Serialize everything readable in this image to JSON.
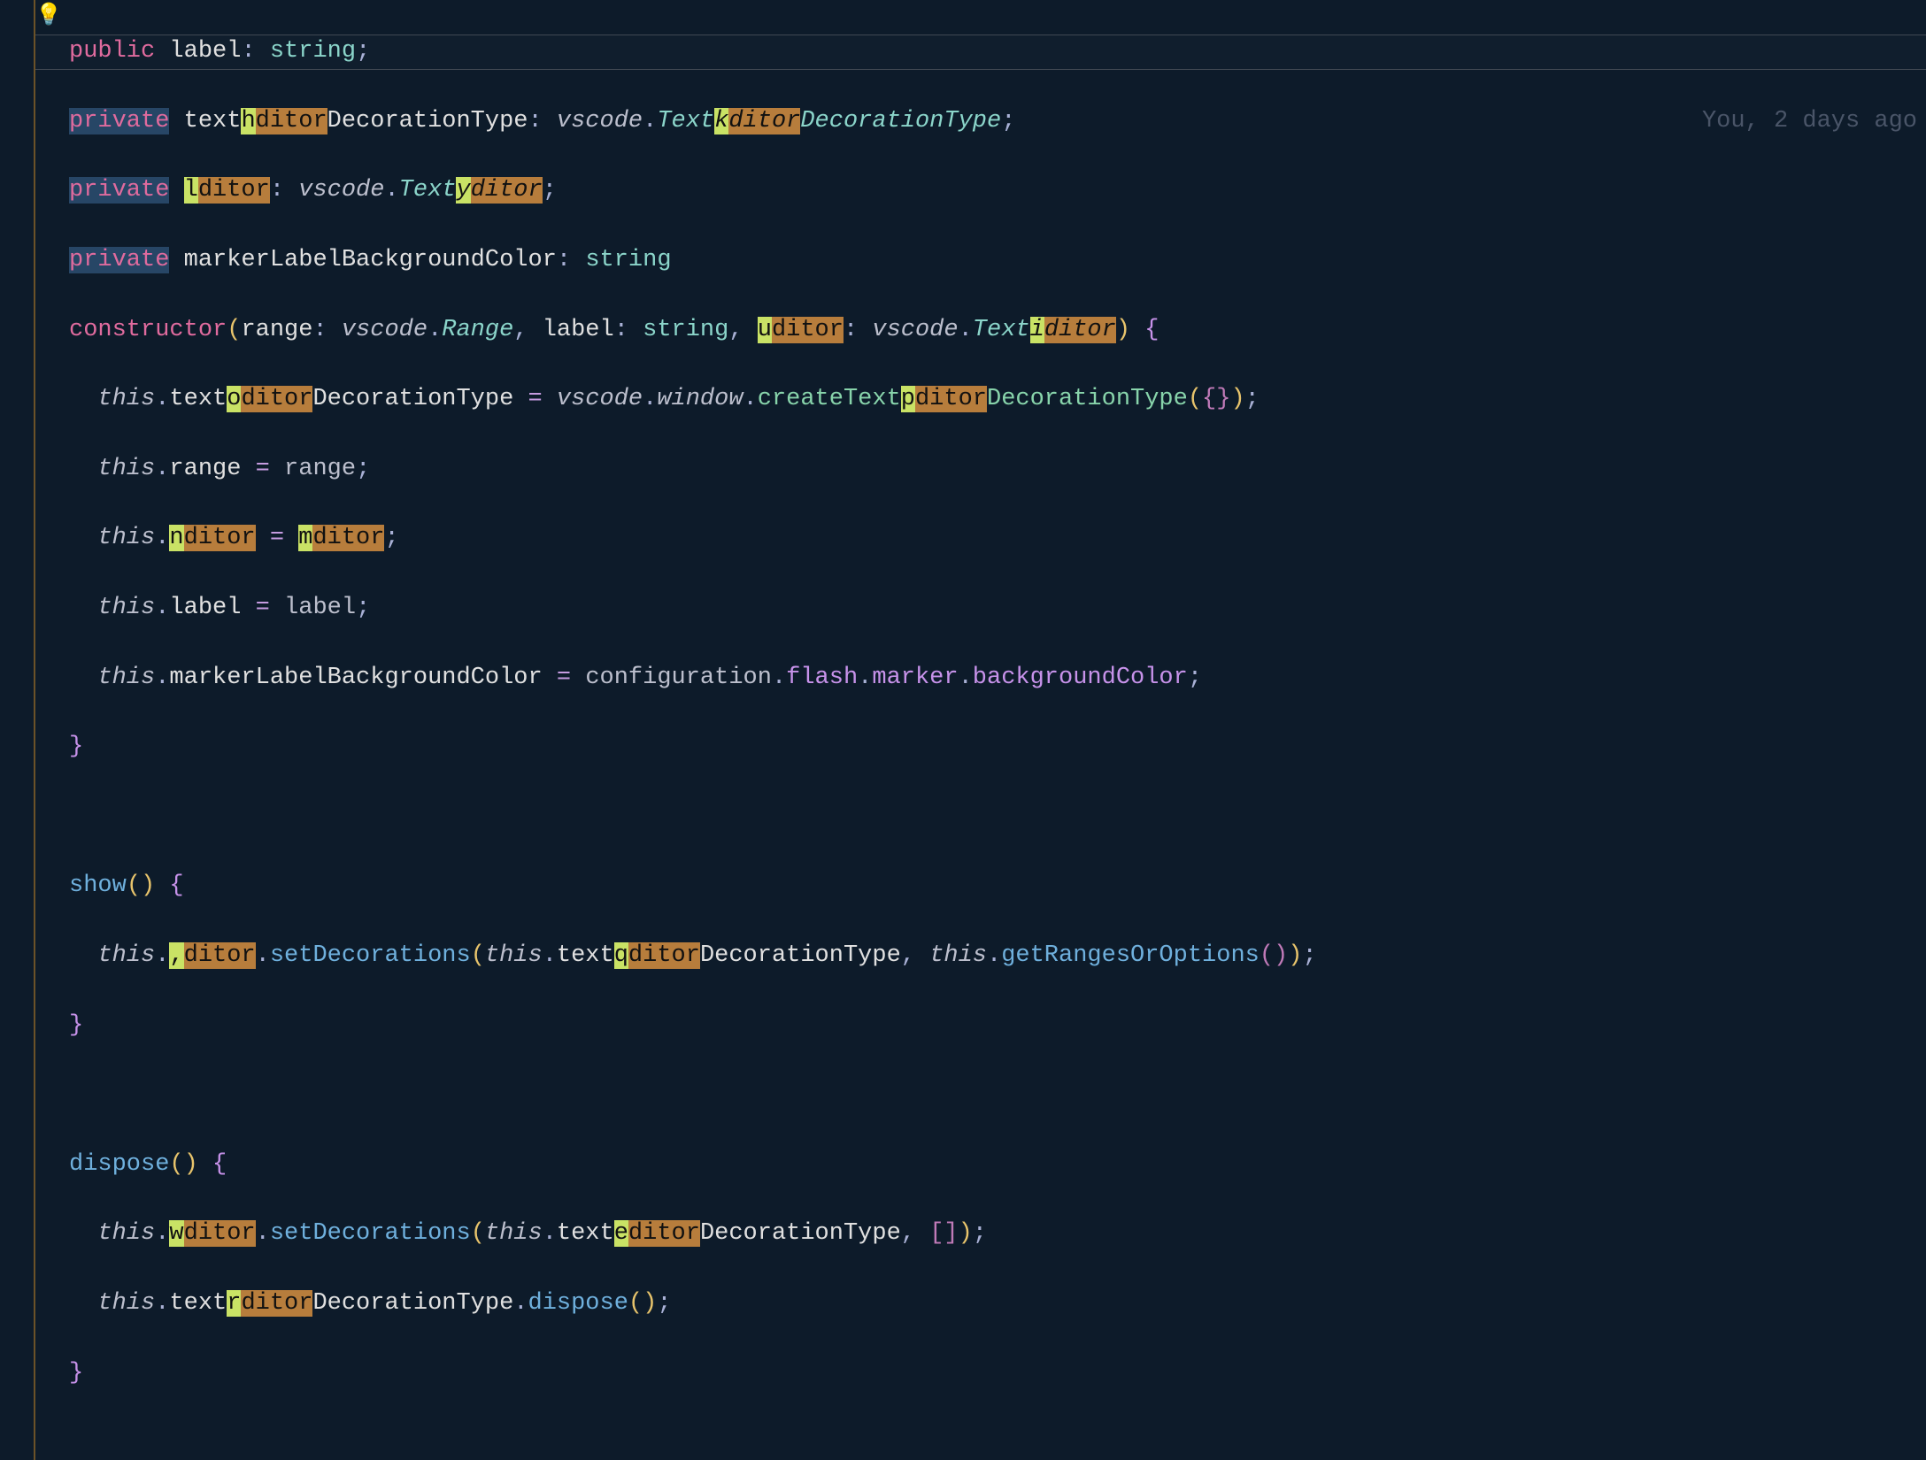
{
  "blame": "You, 2 days ago",
  "markers": {
    "h": {
      "key": "h",
      "tail": "ditor"
    },
    "k": {
      "key": "k",
      "tail": "ditor"
    },
    "l": {
      "key": "l",
      "tail": "ditor"
    },
    "y": {
      "key": "y",
      "tail": "ditor"
    },
    "u": {
      "key": "u",
      "tail": "ditor"
    },
    "i": {
      "key": "i",
      "tail": "ditor"
    },
    "o": {
      "key": "o",
      "tail": "ditor"
    },
    "p": {
      "key": "p",
      "tail": "ditor"
    },
    "n": {
      "key": "n",
      "tail": "ditor"
    },
    "m": {
      "key": "m",
      "tail": "ditor"
    },
    "comma": {
      "key": ",",
      "tail": "ditor"
    },
    "q": {
      "key": "q",
      "tail": "ditor"
    },
    "w": {
      "key": "w",
      "tail": "ditor"
    },
    "e": {
      "key": "e",
      "tail": "ditor"
    },
    "r": {
      "key": "r",
      "tail": "ditor"
    }
  },
  "tokens": {
    "public": "public",
    "private": "private",
    "constructor": "constructor",
    "this": "this",
    "label": "label",
    "string": "string",
    "textE": "text",
    "DecorationType": "DecorationType",
    "vscode": "vscode",
    "Text": "Text",
    "Range": "Range",
    "range": "range",
    "window": "window",
    "createText": "createText",
    "markerLabelBackgroundColor": "markerLabelBackgroundColor",
    "show": "show",
    "dispose": "dispose",
    "setDecorations": "setDecorations",
    "getRangesOrOptions": "getRangesOrOptions",
    "configuration": "configuration",
    "flash": "flash",
    "marker": "marker",
    "backgroundColor": "backgroundColor"
  }
}
